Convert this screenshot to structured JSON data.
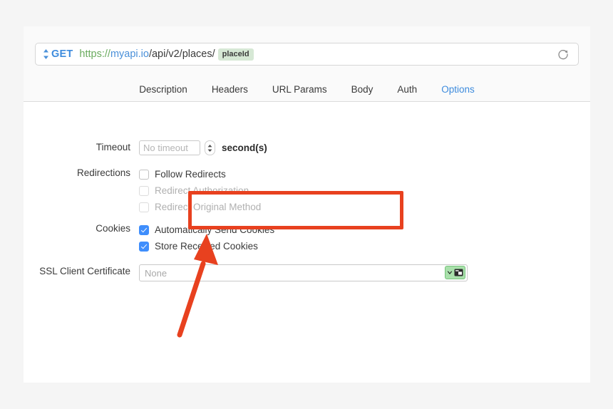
{
  "window": {
    "request_bar": {
      "method": "GET",
      "method_selector_icon": "updown-arrows-icon",
      "url_scheme": "https://",
      "url_host": "myapi.io",
      "url_path": "/api/v2/places/",
      "url_param_badge": "placeId",
      "reload_icon": "reload-icon"
    },
    "tabs": [
      {
        "label": "Description",
        "active": false
      },
      {
        "label": "Headers",
        "active": false
      },
      {
        "label": "URL Params",
        "active": false
      },
      {
        "label": "Body",
        "active": false
      },
      {
        "label": "Auth",
        "active": false
      },
      {
        "label": "Options",
        "active": true
      }
    ],
    "options_panel": {
      "timeout": {
        "label": "Timeout",
        "value": "",
        "placeholder": "No timeout",
        "stepper_icon": "stepper-updown-icon",
        "units": "second(s)"
      },
      "redirections": {
        "label": "Redirections",
        "items": [
          {
            "label": "Follow Redirects",
            "checked": false,
            "disabled": false
          },
          {
            "label": "Redirect Authorization",
            "checked": false,
            "disabled": true
          },
          {
            "label": "Redirect Original Method",
            "checked": false,
            "disabled": true
          }
        ]
      },
      "cookies": {
        "label": "Cookies",
        "items": [
          {
            "label": "Automatically Send Cookies",
            "checked": true,
            "disabled": false
          },
          {
            "label": "Store Received Cookies",
            "checked": true,
            "disabled": false
          }
        ]
      },
      "ssl_client_certificate": {
        "label": "SSL Client Certificate",
        "value": "",
        "placeholder": "None",
        "picker_chevron_icon": "chevron-down-icon",
        "picker_window_icon": "certificate-picker-icon"
      }
    }
  },
  "annotations": {
    "highlight_color": "#e8411f",
    "arrow_color": "#e8411f",
    "highlight_target": "cookies-section",
    "arrow_target": "ssl-client-certificate-label"
  },
  "theme": {
    "accent_blue": "#3d8bdd",
    "checkbox_blue": "#3f8efc",
    "scheme_green": "#6aab5e",
    "host_blue": "#4a90d9",
    "badge_green": "#d6e8d5",
    "picker_green": "#a9e0ab",
    "page_background": "#f5f5f5",
    "panel_background": "#ffffff"
  }
}
